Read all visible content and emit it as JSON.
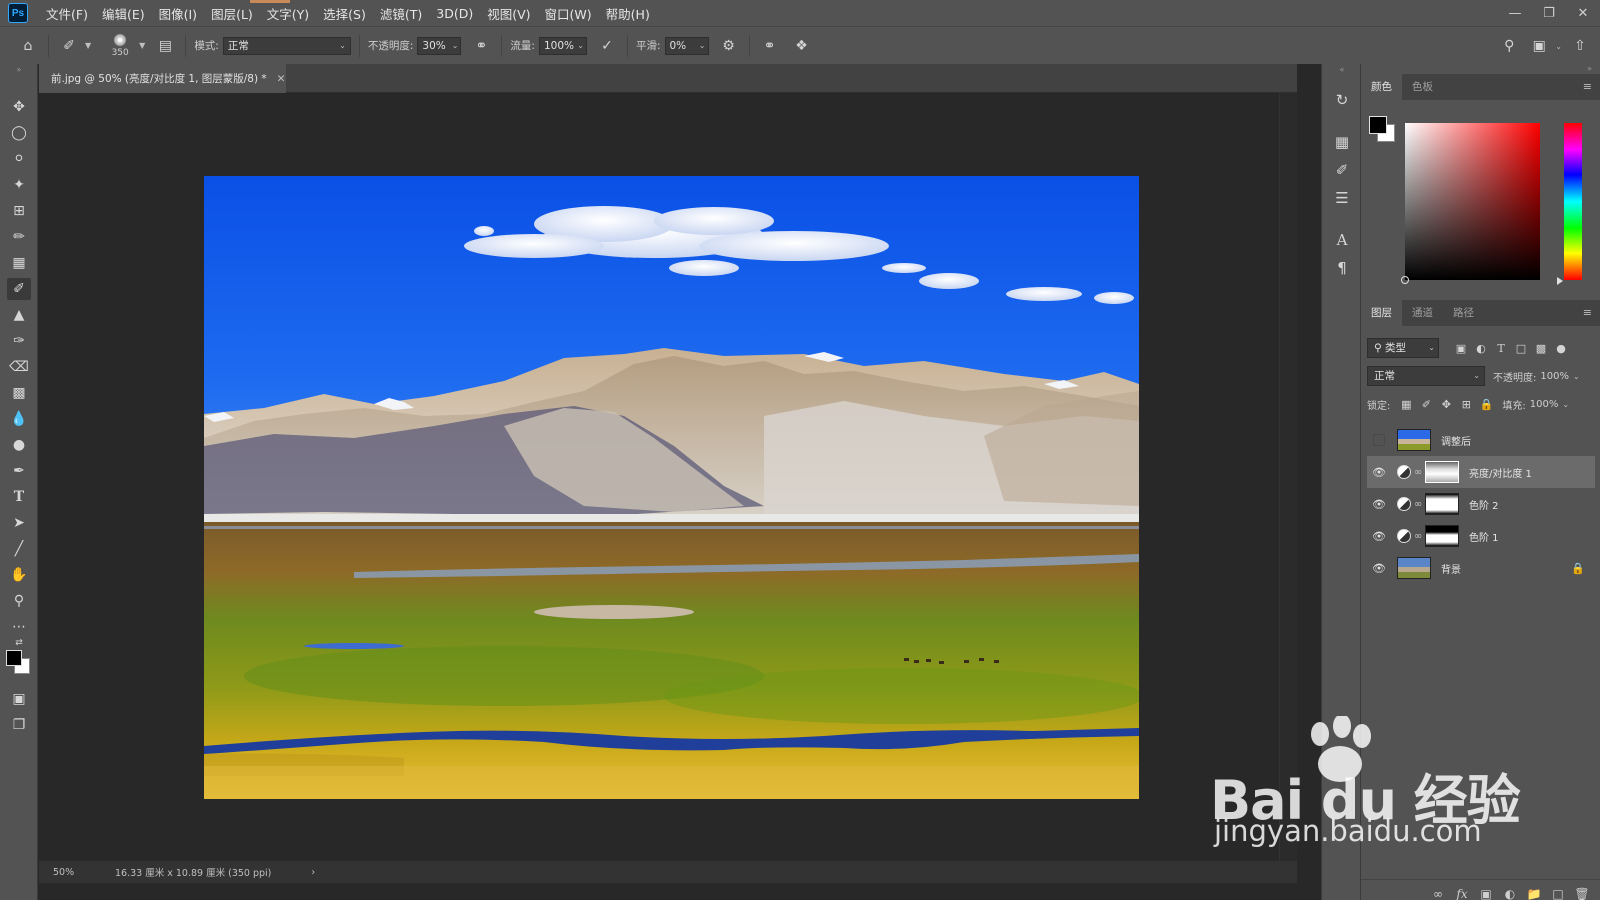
{
  "app": {
    "logo": "Ps",
    "menu": [
      "文件(F)",
      "编辑(E)",
      "图像(I)",
      "图层(L)",
      "文字(Y)",
      "选择(S)",
      "滤镜(T)",
      "3D(D)",
      "视图(V)",
      "窗口(W)",
      "帮助(H)"
    ],
    "window_controls": [
      "minimize-icon",
      "restore-icon",
      "close-icon"
    ]
  },
  "options": {
    "brush_size": "350",
    "mode_label": "模式:",
    "mode_value": "正常",
    "opacity_label": "不透明度:",
    "opacity_value": "30%",
    "flow_label": "流量:",
    "flow_value": "100%",
    "smooth_label": "平滑:",
    "smooth_value": "0%"
  },
  "document": {
    "tab_title": "前.jpg @ 50% (亮度/对比度 1, 图层蒙版/8) *",
    "zoom": "50%",
    "doc_info": "16.33 厘米 x 10.89 厘米 (350 ppi)"
  },
  "color_panel": {
    "tabs": [
      "颜色",
      "色板"
    ],
    "foreground": "#000000",
    "background": "#ffffff"
  },
  "layers_panel": {
    "tabs": [
      "图层",
      "通道",
      "路径"
    ],
    "filter_label": "类型",
    "blend_mode": "正常",
    "opacity_label": "不透明度:",
    "opacity_value": "100%",
    "lock_label": "锁定:",
    "fill_label": "填充:",
    "fill_value": "100%",
    "layers": [
      {
        "name": "调整后",
        "visible": false,
        "type": "image"
      },
      {
        "name": "亮度/对比度 1",
        "visible": true,
        "type": "adjustment",
        "selected": true
      },
      {
        "name": "色阶 2",
        "visible": true,
        "type": "adjustment"
      },
      {
        "name": "色阶 1",
        "visible": true,
        "type": "adjustment"
      },
      {
        "name": "背景",
        "visible": true,
        "type": "image",
        "locked": true
      }
    ]
  },
  "watermark": {
    "brand": "Bai du 经验",
    "url": "jingyan.baidu.com"
  }
}
